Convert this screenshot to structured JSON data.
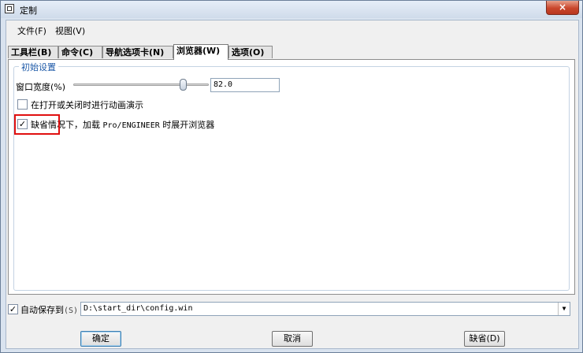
{
  "window": {
    "title": "定制",
    "close_label": "×"
  },
  "menubar": {
    "items": [
      {
        "label": "文件(F)"
      },
      {
        "label": "视图(V)"
      }
    ]
  },
  "tabs": [
    {
      "label": "工具栏(B)",
      "active": false
    },
    {
      "label": "命令(C)",
      "active": false
    },
    {
      "label": "导航选项卡(N)",
      "active": false
    },
    {
      "label": "浏览器(W)",
      "active": true
    },
    {
      "label": "选项(O)",
      "active": false
    }
  ],
  "browser_tab": {
    "group_title": "初始设置",
    "window_width": {
      "label": "窗口宽度(%)",
      "value": "82.0",
      "slider_percent": 82.0
    },
    "animate_option": {
      "label": "在打开或关闭时进行动画演示",
      "checked": false
    },
    "default_open_option": {
      "label_highlighted": "缺省情",
      "label_rest": "况下，加载",
      "label_product": "Pro/ENGINEER",
      "label_tail": "时展开浏览器",
      "checked": true
    }
  },
  "autosave": {
    "label": "自动保存到",
    "shortcut": "(S)",
    "checked": true,
    "path": "D:\\start_dir\\config.win"
  },
  "buttons": {
    "ok": "确定",
    "cancel": "取消",
    "default": "缺省(D)"
  },
  "icons": {
    "checkmark": "✓",
    "dropdown": "▼"
  },
  "colors": {
    "highlight": "#e01010",
    "group_title": "#1e5aa8"
  }
}
